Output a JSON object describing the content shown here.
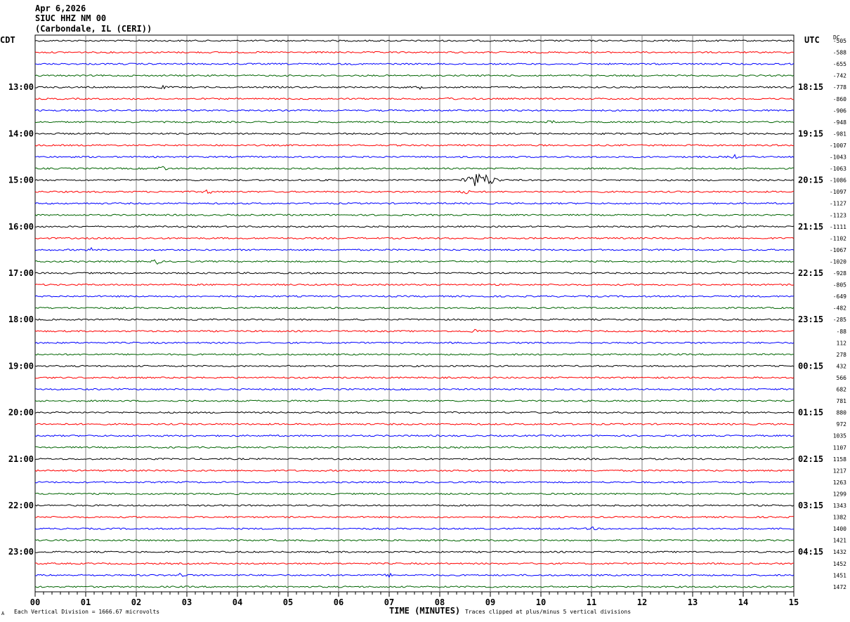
{
  "header": {
    "date": "Apr 6,2026",
    "station": "SIUC HHZ NM 00",
    "location": "(Carbondale, IL (CERI))"
  },
  "axis_labels": {
    "left": "CDT",
    "right": "UTC",
    "dc": "DC"
  },
  "footer": {
    "left": "Each Vertical Division = 1666.67 microvolts",
    "right": "Traces clipped at plus/minus 5 vertical divisions",
    "mark": "A"
  },
  "colors": {
    "cycle": [
      "#000000",
      "#ff0000",
      "#0000ff",
      "#006400"
    ],
    "grid": "#808080"
  },
  "chart_data": {
    "type": "line",
    "title": "SIUC HHZ NM 00",
    "xlabel": "TIME (MINUTES)",
    "ylabel": "",
    "xlim": [
      0,
      15
    ],
    "x_ticks": [
      "00",
      "01",
      "02",
      "03",
      "04",
      "05",
      "06",
      "07",
      "08",
      "09",
      "10",
      "11",
      "12",
      "13",
      "14",
      "15"
    ],
    "left_time_labels": [
      "13:00",
      "14:00",
      "15:00",
      "16:00",
      "17:00",
      "18:00",
      "19:00",
      "20:00",
      "21:00",
      "22:00",
      "23:00"
    ],
    "right_time_labels": [
      "18:15",
      "19:15",
      "20:15",
      "21:15",
      "22:15",
      "23:15",
      "00:15",
      "01:15",
      "02:15",
      "03:15",
      "04:15"
    ],
    "dc_offsets": [
      "-505",
      "-588",
      "-655",
      "-742",
      "-778",
      "-860",
      "-906",
      "-948",
      "-981",
      "-1007",
      "-1043",
      "-1063",
      "-1086",
      "-1097",
      "-1127",
      "-1123",
      "-1111",
      "-1102",
      "-1067",
      "-1020",
      "-928",
      "-805",
      "-649",
      "-482",
      "-285",
      "-88",
      "112",
      "278",
      "432",
      "566",
      "682",
      "781",
      "880",
      "972",
      "1035",
      "1107",
      "1158",
      "1217",
      "1263",
      "1299",
      "1343",
      "1382",
      "1400",
      "1421",
      "1432",
      "1452",
      "1451",
      "1472"
    ],
    "events": [
      {
        "trace": 12,
        "minute": 8.8,
        "amplitude": 2.5
      },
      {
        "trace": 11,
        "minute": 2.5,
        "amplitude": 1.2
      },
      {
        "trace": 13,
        "minute": 3.4,
        "amplitude": 0.8
      },
      {
        "trace": 13,
        "minute": 8.5,
        "amplitude": 0.7
      },
      {
        "trace": 10,
        "minute": 13.8,
        "amplitude": 0.8
      },
      {
        "trace": 19,
        "minute": 2.4,
        "amplitude": 0.9
      },
      {
        "trace": 18,
        "minute": 1.1,
        "amplitude": 0.6
      },
      {
        "trace": 25,
        "minute": 8.7,
        "amplitude": 0.7
      },
      {
        "trace": 42,
        "minute": 11.0,
        "amplitude": 0.5
      },
      {
        "trace": 46,
        "minute": 2.9,
        "amplitude": 1.0
      },
      {
        "trace": 46,
        "minute": 7.0,
        "amplitude": 0.5
      },
      {
        "trace": 7,
        "minute": 10.2,
        "amplitude": 0.5
      },
      {
        "trace": 5,
        "minute": 8.2,
        "amplitude": 0.5
      },
      {
        "trace": 4,
        "minute": 2.5,
        "amplitude": 0.5
      },
      {
        "trace": 4,
        "minute": 7.6,
        "amplitude": 0.5
      }
    ]
  }
}
